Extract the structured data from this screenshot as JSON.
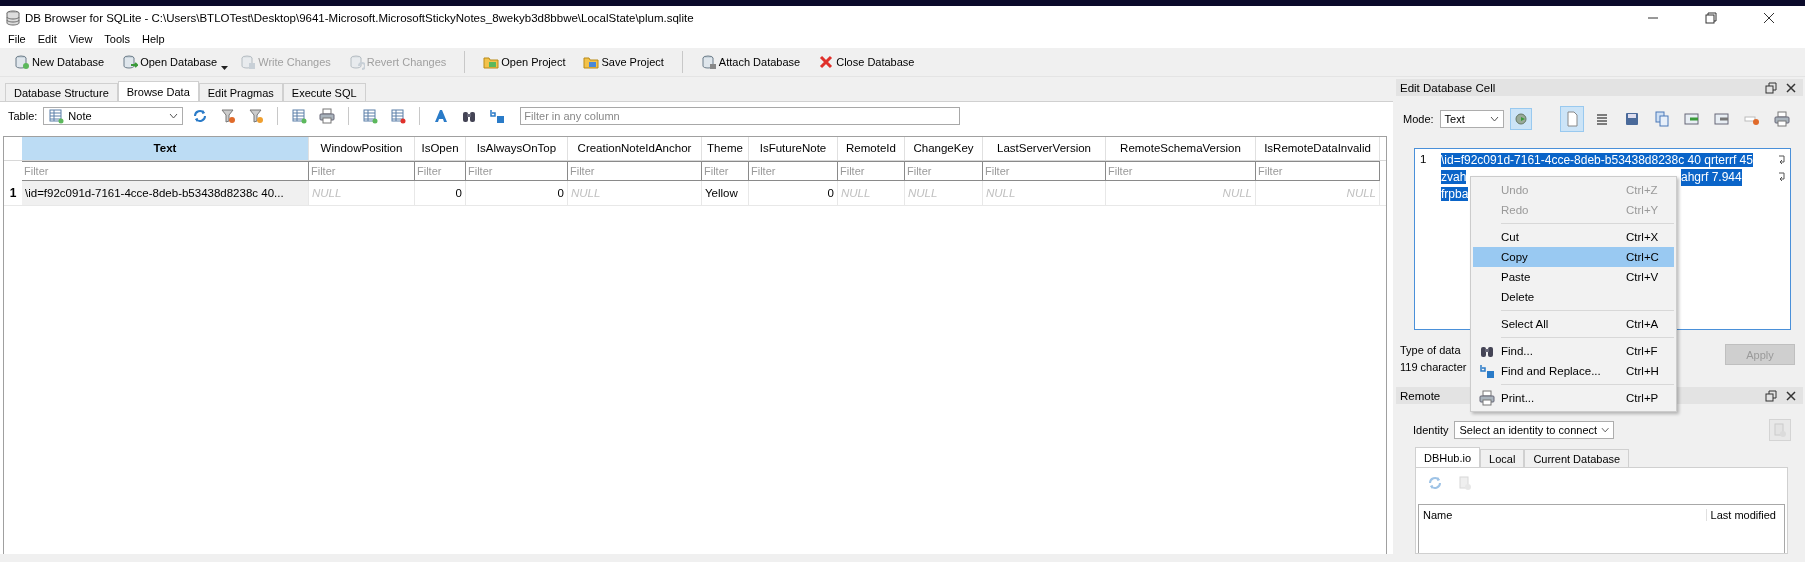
{
  "window": {
    "title": "DB Browser for SQLite - C:\\Users\\BTLOTest\\Desktop\\9641-Microsoft.MicrosoftStickyNotes_8wekyb3d8bbwe\\LocalState\\plum.sqlite"
  },
  "menu": [
    "File",
    "Edit",
    "View",
    "Tools",
    "Help"
  ],
  "toolbar": [
    {
      "kind": "button",
      "label": "New Database",
      "disabled": false,
      "dropdown": false
    },
    {
      "kind": "button",
      "label": "Open Database",
      "disabled": false,
      "dropdown": true
    },
    {
      "kind": "button",
      "label": "Write Changes",
      "disabled": true,
      "dropdown": false
    },
    {
      "kind": "button",
      "label": "Revert Changes",
      "disabled": true,
      "dropdown": false
    },
    {
      "kind": "separator"
    },
    {
      "kind": "button",
      "label": "Open Project",
      "disabled": false,
      "dropdown": false
    },
    {
      "kind": "button",
      "label": "Save Project",
      "disabled": false,
      "dropdown": false
    },
    {
      "kind": "separator"
    },
    {
      "kind": "button",
      "label": "Attach Database",
      "disabled": false,
      "dropdown": false
    },
    {
      "kind": "button",
      "label": "Close Database",
      "disabled": false,
      "dropdown": false
    }
  ],
  "tabs": [
    {
      "label": "Database Structure",
      "selected": false
    },
    {
      "label": "Browse Data",
      "selected": true
    },
    {
      "label": "Edit Pragmas",
      "selected": false
    },
    {
      "label": "Execute SQL",
      "selected": false
    }
  ],
  "browse": {
    "table_label": "Table:",
    "table": "Note",
    "filter": {
      "placeholder": "Filter in any column"
    }
  },
  "grid": {
    "columns": [
      {
        "label": "Text",
        "selected": true,
        "filter_placeholder": "Filter"
      },
      {
        "label": "WindowPosition",
        "selected": false,
        "filter_placeholder": "Filter"
      },
      {
        "label": "IsOpen",
        "selected": false,
        "filter_placeholder": "Filter"
      },
      {
        "label": "IsAlwaysOnTop",
        "selected": false,
        "filter_placeholder": "Filter"
      },
      {
        "label": "CreationNoteIdAnchor",
        "selected": false,
        "filter_placeholder": "Filter"
      },
      {
        "label": "Theme",
        "selected": false,
        "filter_placeholder": "Filter"
      },
      {
        "label": "IsFutureNote",
        "selected": false,
        "filter_placeholder": "Filter"
      },
      {
        "label": "RemoteId",
        "selected": false,
        "filter_placeholder": "Filter"
      },
      {
        "label": "ChangeKey",
        "selected": false,
        "filter_placeholder": "Filter"
      },
      {
        "label": "LastServerVersion",
        "selected": false,
        "filter_placeholder": "Filter"
      },
      {
        "label": "RemoteSchemaVersion",
        "selected": false,
        "filter_placeholder": "Filter"
      },
      {
        "label": "IsRemoteDataInvalid",
        "selected": false,
        "filter_placeholder": "Filter"
      }
    ],
    "rows": [
      {
        "number": "1",
        "cells": [
          {
            "kind": "text",
            "text": "\\id=f92c091d-7161-4cce-8deb-b53438d8238c 40...",
            "selected": true
          },
          {
            "kind": "null",
            "text": "NULL",
            "selected": false
          },
          {
            "kind": "number",
            "text": "0",
            "selected": false
          },
          {
            "kind": "number",
            "text": "0",
            "selected": false
          },
          {
            "kind": "null",
            "text": "NULL",
            "selected": false
          },
          {
            "kind": "text",
            "text": "Yellow",
            "selected": false
          },
          {
            "kind": "number",
            "text": "0",
            "selected": false
          },
          {
            "kind": "null",
            "text": "NULL",
            "selected": false
          },
          {
            "kind": "null",
            "text": "NULL",
            "selected": false
          },
          {
            "kind": "null",
            "text": "NULL",
            "selected": false
          },
          {
            "kind": "null-numeric",
            "text": "NULL",
            "selected": false
          },
          {
            "kind": "null-numeric",
            "text": "NULL",
            "selected": false
          }
        ]
      }
    ]
  },
  "edit_cell": {
    "title": "Edit Database Cell",
    "mode_label": "Mode:",
    "mode": "Text",
    "line_number": "1",
    "selected": true,
    "lines": [
      [
        "\\id=f92c091d-7161-4cce-8deb-b53438d8238c 40 qrterrf 45"
      ],
      [
        "zvah",
        "ahgrf 7.944"
      ],
      [
        "frpba"
      ]
    ],
    "type_label": "Type of data",
    "size_label": "119 character",
    "apply": {
      "label": "Apply",
      "disabled": true
    }
  },
  "context_menu": [
    {
      "kind": "item",
      "label": "Undo",
      "shortcut": "Ctrl+Z",
      "disabled": true,
      "selected": false
    },
    {
      "kind": "item",
      "label": "Redo",
      "shortcut": "Ctrl+Y",
      "disabled": true,
      "selected": false
    },
    {
      "kind": "separator"
    },
    {
      "kind": "item",
      "label": "Cut",
      "shortcut": "Ctrl+X",
      "disabled": false,
      "selected": false
    },
    {
      "kind": "item",
      "label": "Copy",
      "shortcut": "Ctrl+C",
      "disabled": false,
      "selected": true
    },
    {
      "kind": "item",
      "label": "Paste",
      "shortcut": "Ctrl+V",
      "disabled": false,
      "selected": false
    },
    {
      "kind": "item",
      "label": "Delete",
      "disabled": false,
      "selected": false
    },
    {
      "kind": "separator"
    },
    {
      "kind": "item",
      "label": "Select All",
      "shortcut": "Ctrl+A",
      "disabled": false,
      "selected": false
    },
    {
      "kind": "separator"
    },
    {
      "kind": "item",
      "label": "Find...",
      "shortcut": "Ctrl+F",
      "disabled": false,
      "selected": false
    },
    {
      "kind": "item",
      "label": "Find and Replace...",
      "shortcut": "Ctrl+H",
      "disabled": false,
      "selected": false
    },
    {
      "kind": "separator"
    },
    {
      "kind": "item",
      "label": "Print...",
      "shortcut": "Ctrl+P",
      "disabled": false,
      "selected": false
    }
  ],
  "remote": {
    "title": "Remote",
    "identity_label": "Identity",
    "identity": "Select an identity to connect",
    "tabs": [
      {
        "label": "DBHub.io",
        "selected": true
      },
      {
        "label": "Local",
        "selected": false
      },
      {
        "label": "Current Database",
        "selected": false
      }
    ],
    "columns": [
      "Name",
      "Last modified"
    ]
  }
}
